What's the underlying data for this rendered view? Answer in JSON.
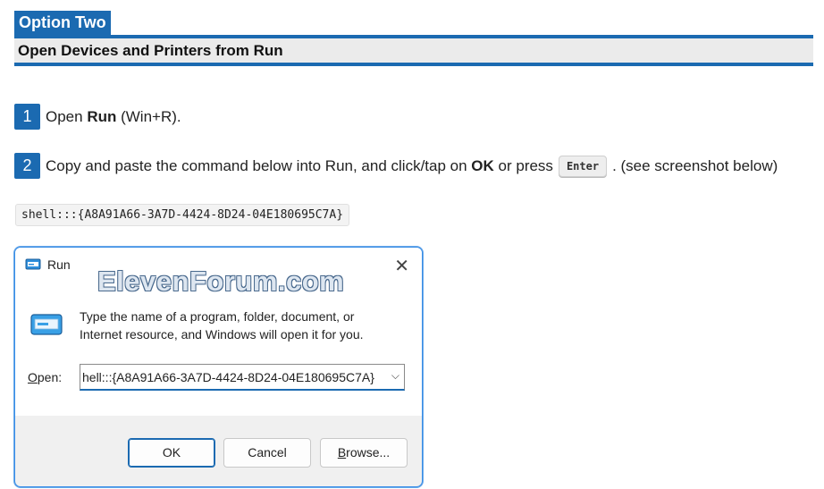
{
  "option_tab": "Option Two",
  "header_title": "Open Devices and Printers from Run",
  "steps": [
    {
      "num": "1",
      "pre": "Open ",
      "bold": "Run",
      "post": " (Win+R)."
    },
    {
      "num": "2",
      "pre": "Copy and paste the command below into Run, and click/tap on ",
      "bold": "OK",
      "mid": " or press",
      "key": "Enter",
      "post": ". (see screenshot below)"
    }
  ],
  "command": "shell:::{A8A91A66-3A7D-4424-8D24-04E180695C7A}",
  "dialog": {
    "title": "Run",
    "watermark": "ElevenForum.com",
    "description_line1": "Type the name of a program, folder, document, or",
    "description_line2": "Internet resource, and Windows will open it for you.",
    "open_label_u": "O",
    "open_label_rest": "pen:",
    "open_value": "hell:::{A8A91A66-3A7D-4424-8D24-04E180695C7A}",
    "ok_label": "OK",
    "cancel_label": "Cancel",
    "browse_label_u": "B",
    "browse_label_rest": "rowse...",
    "close_glyph": "✕",
    "arrow_glyph": "⌵"
  },
  "colors": {
    "accent": "#1b6ab1",
    "header_bg": "#ebebeb",
    "dialog_bg": "#f0f0f0"
  }
}
